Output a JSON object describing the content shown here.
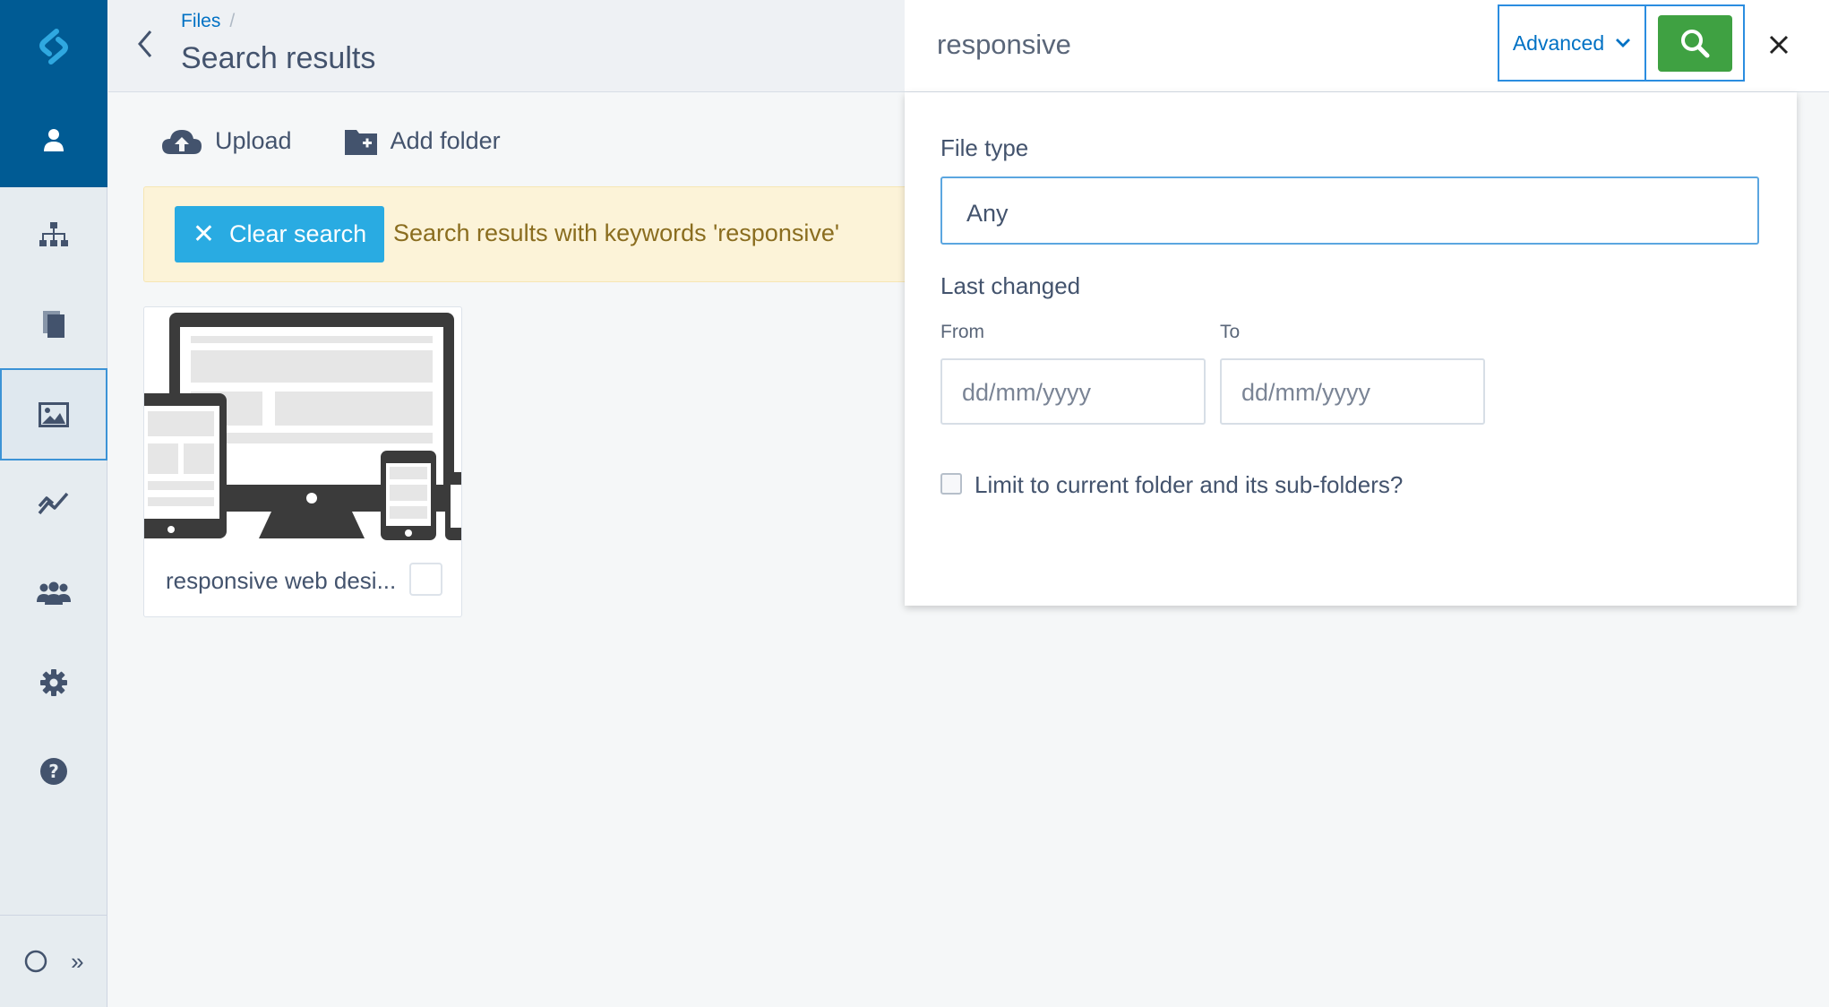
{
  "colors": {
    "brand_blue": "#005b94",
    "link_blue": "#0071c4",
    "clear_button": "#29abe2",
    "search_button": "#3fa142",
    "notice_bg": "#fcf3d8",
    "notice_text": "#8a6d1f"
  },
  "sidebar": {
    "logo_icon": "silverstripe-logo-icon",
    "items": [
      {
        "icon": "user-icon"
      },
      {
        "icon": "sitetree-icon"
      },
      {
        "icon": "pages-icon"
      },
      {
        "icon": "image-icon"
      },
      {
        "icon": "chart-icon"
      },
      {
        "icon": "users-icon"
      },
      {
        "icon": "gear-icon"
      },
      {
        "icon": "help-icon"
      }
    ],
    "collapse_label": "»"
  },
  "header": {
    "breadcrumb": "Files",
    "breadcrumb_sep": "/",
    "title": "Search results"
  },
  "toolbar": {
    "upload_label": "Upload",
    "add_folder_label": "Add folder"
  },
  "notice": {
    "clear_label": "Clear search",
    "message": "Search results with keywords 'responsive'"
  },
  "files": [
    {
      "name": "responsive web desi..."
    }
  ],
  "search": {
    "query": "responsive",
    "advanced_label": "Advanced",
    "file_type_label": "File type",
    "file_type_value": "Any",
    "last_changed_label": "Last changed",
    "from_label": "From",
    "to_label": "To",
    "date_placeholder": "dd/mm/yyyy",
    "limit_label": "Limit to current folder and its sub-folders?"
  }
}
